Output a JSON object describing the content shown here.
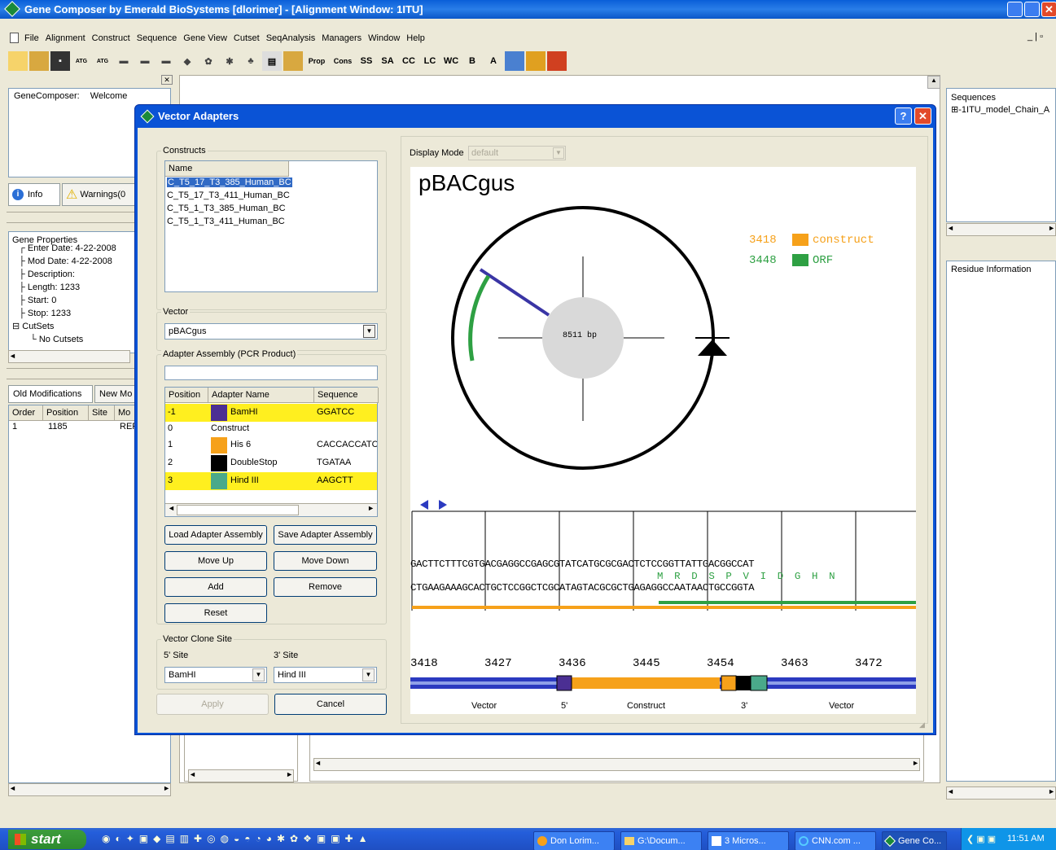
{
  "app": {
    "title": "Gene Composer by Emerald BioSystems [dlorimer] - [Alignment Window: 1ITU]"
  },
  "menu": [
    "File",
    "Alignment",
    "Construct",
    "Sequence",
    "Gene View",
    "Cutset",
    "SeqAnalysis",
    "Managers",
    "Window",
    "Help"
  ],
  "toolbar": {
    "text_buttons": [
      "Prop",
      "Cons",
      "SS",
      "SA",
      "CC",
      "LC",
      "WC",
      "B",
      "A"
    ]
  },
  "left": {
    "welcome_label": "GeneComposer:",
    "welcome_value": "Welcome",
    "tabs": [
      "Info",
      "Warnings(0"
    ],
    "gene_properties_title": "Gene Properties",
    "tree": [
      "Enter Date: 4-22-2008",
      "Mod Date: 4-22-2008",
      "Description:",
      "Length: 1233",
      "Start: 0",
      "Stop: 1233",
      "CutSets",
      "No Cutsets"
    ],
    "mod_tabs": [
      "Old Modifications",
      "New Mo"
    ],
    "mod_cols": [
      "Order",
      "Position",
      "Site",
      "Mo"
    ],
    "mod_row": [
      "1",
      "1185",
      "REF"
    ]
  },
  "right": {
    "sequences_title": "Sequences",
    "seq_item": "1ITU_model_Chain_A",
    "residue_title": "Residue Information"
  },
  "dialog": {
    "title": "Vector Adapters",
    "constructs_label": "Constructs",
    "name_col": "Name",
    "constructs": [
      "C_T5_17_T3_385_Human_BC",
      "C_T5_17_T3_411_Human_BC",
      "C_T5_1_T3_385_Human_BC",
      "C_T5_1_T3_411_Human_BC"
    ],
    "vector_label": "Vector",
    "vector_value": "pBACgus",
    "assembly_label": "Adapter Assembly (PCR Product)",
    "assembly_cols": [
      "Position",
      "Adapter Name",
      "Sequence"
    ],
    "assembly_rows": [
      {
        "pos": "-1",
        "name": "BamHI",
        "seq": "GGATCC",
        "color": "#4b2f93",
        "hl": true
      },
      {
        "pos": "0",
        "name": "Construct",
        "seq": "",
        "color": "",
        "hl": false
      },
      {
        "pos": "1",
        "name": "His 6",
        "seq": "CACCACCATC",
        "color": "#f6a11a",
        "hl": false
      },
      {
        "pos": "2",
        "name": "DoubleStop",
        "seq": "TGATAA",
        "color": "#000000",
        "hl": false
      },
      {
        "pos": "3",
        "name": "Hind III",
        "seq": "AAGCTT",
        "color": "#4aa98a",
        "hl": true
      }
    ],
    "buttons": {
      "load": "Load Adapter Assembly",
      "save": "Save Adapter Assembly",
      "move_up": "Move Up",
      "move_down": "Move Down",
      "add": "Add",
      "remove": "Remove",
      "reset": "Reset",
      "apply": "Apply",
      "cancel": "Cancel"
    },
    "clone_label": "Vector Clone Site",
    "five_label": "5' Site",
    "three_label": "3' Site",
    "five_value": "BamHI",
    "three_value": "Hind III",
    "display_mode_label": "Display Mode",
    "display_mode_value": "default",
    "map": {
      "name": "pBACgus",
      "bp": "8511 bp",
      "legend": [
        {
          "num": "3418",
          "label": "construct",
          "color": "#f6a11a"
        },
        {
          "num": "3448",
          "label": "ORF",
          "color": "#2ea043"
        }
      ]
    },
    "seq": {
      "top": "GACTTCTTTCGTGACGAGGCCGAGCGTATCATGCGCGACTCTCCGGTTATTGACGGCCAT",
      "aa": "M  R  D  S  P  V  I  D  G  H  N",
      "bottom": "CTGAAGAAAGCACTGCTCCGGCTCGCATAGTACGCGCTGAGAGGCCAATAACTGCCGGTA",
      "positions": [
        "3418",
        "3427",
        "3436",
        "3445",
        "3454",
        "3463",
        "3472"
      ],
      "segments": [
        "Vector",
        "5'",
        "Construct",
        "3'",
        "Vector"
      ]
    }
  },
  "taskbar": {
    "start": "start",
    "tasks": [
      "Don Lorim...",
      "G:\\Docum...",
      "3 Micros...",
      "CNN.com ...",
      "Gene Co..."
    ],
    "clock": "11:51 AM"
  }
}
